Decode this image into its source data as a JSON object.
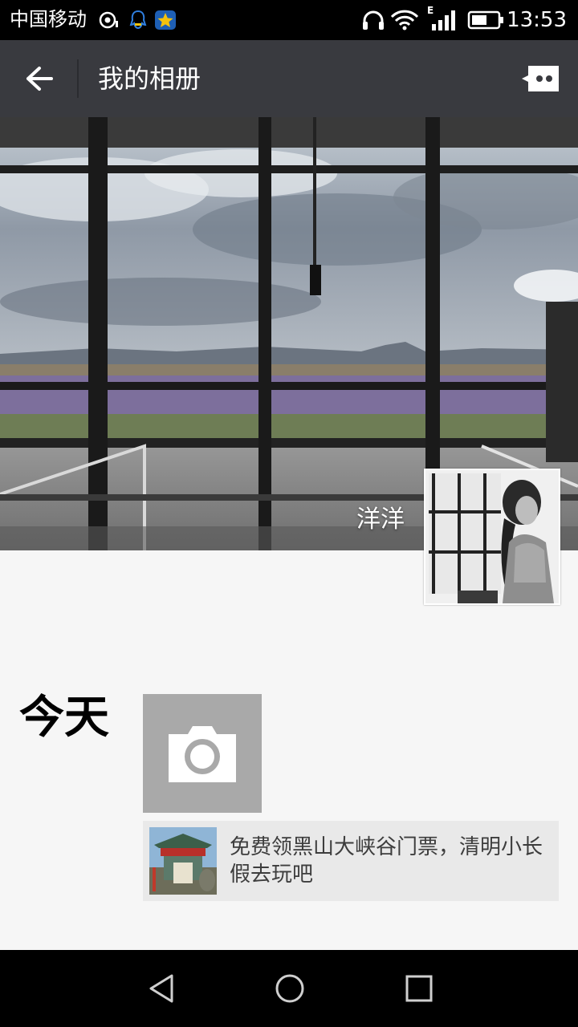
{
  "status_bar": {
    "carrier": "中国移动",
    "network_type": "E",
    "time": "13:53"
  },
  "header": {
    "title": "我的相册"
  },
  "profile": {
    "nickname": "洋洋"
  },
  "timeline": {
    "day_label": "今天",
    "shared_post": {
      "text": "免费领黑山大峡谷门票，清明小长假去玩吧"
    }
  },
  "colors": {
    "title_bar": "#393a3f",
    "status_bar": "#000000",
    "page_background": "#f6f6f6",
    "camera_tile": "#a9a9a9",
    "shared_post_background": "#e9e9e9"
  },
  "icons": {
    "back": "arrow-left-icon",
    "message": "message-icon",
    "camera": "camera-icon",
    "nav_back": "triangle-back-icon",
    "nav_home": "circle-home-icon",
    "nav_recents": "square-recents-icon"
  }
}
